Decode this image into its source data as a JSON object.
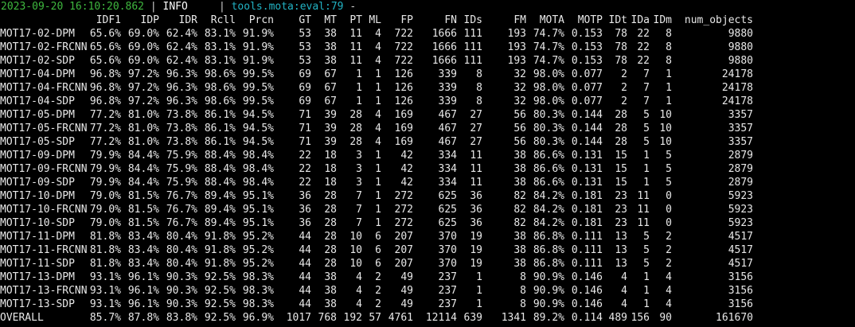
{
  "log": {
    "timestamp": "2023-09-20 16:10:20.862",
    "separator1": " | ",
    "level": "INFO    ",
    "separator2": " | ",
    "location": "tools.mota:eval:79",
    "suffix": " - "
  },
  "table": {
    "columns": [
      "",
      "IDF1",
      "IDP",
      "IDR",
      "Rcll",
      "Prcn",
      "GT",
      "MT",
      "PT",
      "ML",
      "FP",
      "FN",
      "IDs",
      "FM",
      "MOTA",
      "MOTP",
      "IDt",
      "IDa",
      "IDm",
      "num_objects"
    ],
    "rows": [
      [
        "MOT17-02-DPM",
        "65.6%",
        "69.0%",
        "62.4%",
        "83.1%",
        "91.9%",
        "53",
        "38",
        "11",
        "4",
        "722",
        "1666",
        "111",
        "193",
        "74.7%",
        "0.153",
        "78",
        "22",
        "8",
        "9880"
      ],
      [
        "MOT17-02-FRCNN",
        "65.6%",
        "69.0%",
        "62.4%",
        "83.1%",
        "91.9%",
        "53",
        "38",
        "11",
        "4",
        "722",
        "1666",
        "111",
        "193",
        "74.7%",
        "0.153",
        "78",
        "22",
        "8",
        "9880"
      ],
      [
        "MOT17-02-SDP",
        "65.6%",
        "69.0%",
        "62.4%",
        "83.1%",
        "91.9%",
        "53",
        "38",
        "11",
        "4",
        "722",
        "1666",
        "111",
        "193",
        "74.7%",
        "0.153",
        "78",
        "22",
        "8",
        "9880"
      ],
      [
        "MOT17-04-DPM",
        "96.8%",
        "97.2%",
        "96.3%",
        "98.6%",
        "99.5%",
        "69",
        "67",
        "1",
        "1",
        "126",
        "339",
        "8",
        "32",
        "98.0%",
        "0.077",
        "2",
        "7",
        "1",
        "24178"
      ],
      [
        "MOT17-04-FRCNN",
        "96.8%",
        "97.2%",
        "96.3%",
        "98.6%",
        "99.5%",
        "69",
        "67",
        "1",
        "1",
        "126",
        "339",
        "8",
        "32",
        "98.0%",
        "0.077",
        "2",
        "7",
        "1",
        "24178"
      ],
      [
        "MOT17-04-SDP",
        "96.8%",
        "97.2%",
        "96.3%",
        "98.6%",
        "99.5%",
        "69",
        "67",
        "1",
        "1",
        "126",
        "339",
        "8",
        "32",
        "98.0%",
        "0.077",
        "2",
        "7",
        "1",
        "24178"
      ],
      [
        "MOT17-05-DPM",
        "77.2%",
        "81.0%",
        "73.8%",
        "86.1%",
        "94.5%",
        "71",
        "39",
        "28",
        "4",
        "169",
        "467",
        "27",
        "56",
        "80.3%",
        "0.144",
        "28",
        "5",
        "10",
        "3357"
      ],
      [
        "MOT17-05-FRCNN",
        "77.2%",
        "81.0%",
        "73.8%",
        "86.1%",
        "94.5%",
        "71",
        "39",
        "28",
        "4",
        "169",
        "467",
        "27",
        "56",
        "80.3%",
        "0.144",
        "28",
        "5",
        "10",
        "3357"
      ],
      [
        "MOT17-05-SDP",
        "77.2%",
        "81.0%",
        "73.8%",
        "86.1%",
        "94.5%",
        "71",
        "39",
        "28",
        "4",
        "169",
        "467",
        "27",
        "56",
        "80.3%",
        "0.144",
        "28",
        "5",
        "10",
        "3357"
      ],
      [
        "MOT17-09-DPM",
        "79.9%",
        "84.4%",
        "75.9%",
        "88.4%",
        "98.4%",
        "22",
        "18",
        "3",
        "1",
        "42",
        "334",
        "11",
        "38",
        "86.6%",
        "0.131",
        "15",
        "1",
        "5",
        "2879"
      ],
      [
        "MOT17-09-FRCNN",
        "79.9%",
        "84.4%",
        "75.9%",
        "88.4%",
        "98.4%",
        "22",
        "18",
        "3",
        "1",
        "42",
        "334",
        "11",
        "38",
        "86.6%",
        "0.131",
        "15",
        "1",
        "5",
        "2879"
      ],
      [
        "MOT17-09-SDP",
        "79.9%",
        "84.4%",
        "75.9%",
        "88.4%",
        "98.4%",
        "22",
        "18",
        "3",
        "1",
        "42",
        "334",
        "11",
        "38",
        "86.6%",
        "0.131",
        "15",
        "1",
        "5",
        "2879"
      ],
      [
        "MOT17-10-DPM",
        "79.0%",
        "81.5%",
        "76.7%",
        "89.4%",
        "95.1%",
        "36",
        "28",
        "7",
        "1",
        "272",
        "625",
        "36",
        "82",
        "84.2%",
        "0.181",
        "23",
        "11",
        "0",
        "5923"
      ],
      [
        "MOT17-10-FRCNN",
        "79.0%",
        "81.5%",
        "76.7%",
        "89.4%",
        "95.1%",
        "36",
        "28",
        "7",
        "1",
        "272",
        "625",
        "36",
        "82",
        "84.2%",
        "0.181",
        "23",
        "11",
        "0",
        "5923"
      ],
      [
        "MOT17-10-SDP",
        "79.0%",
        "81.5%",
        "76.7%",
        "89.4%",
        "95.1%",
        "36",
        "28",
        "7",
        "1",
        "272",
        "625",
        "36",
        "82",
        "84.2%",
        "0.181",
        "23",
        "11",
        "0",
        "5923"
      ],
      [
        "MOT17-11-DPM",
        "81.8%",
        "83.4%",
        "80.4%",
        "91.8%",
        "95.2%",
        "44",
        "28",
        "10",
        "6",
        "207",
        "370",
        "19",
        "38",
        "86.8%",
        "0.111",
        "13",
        "5",
        "2",
        "4517"
      ],
      [
        "MOT17-11-FRCNN",
        "81.8%",
        "83.4%",
        "80.4%",
        "91.8%",
        "95.2%",
        "44",
        "28",
        "10",
        "6",
        "207",
        "370",
        "19",
        "38",
        "86.8%",
        "0.111",
        "13",
        "5",
        "2",
        "4517"
      ],
      [
        "MOT17-11-SDP",
        "81.8%",
        "83.4%",
        "80.4%",
        "91.8%",
        "95.2%",
        "44",
        "28",
        "10",
        "6",
        "207",
        "370",
        "19",
        "38",
        "86.8%",
        "0.111",
        "13",
        "5",
        "2",
        "4517"
      ],
      [
        "MOT17-13-DPM",
        "93.1%",
        "96.1%",
        "90.3%",
        "92.5%",
        "98.3%",
        "44",
        "38",
        "4",
        "2",
        "49",
        "237",
        "1",
        "8",
        "90.9%",
        "0.146",
        "4",
        "1",
        "4",
        "3156"
      ],
      [
        "MOT17-13-FRCNN",
        "93.1%",
        "96.1%",
        "90.3%",
        "92.5%",
        "98.3%",
        "44",
        "38",
        "4",
        "2",
        "49",
        "237",
        "1",
        "8",
        "90.9%",
        "0.146",
        "4",
        "1",
        "4",
        "3156"
      ],
      [
        "MOT17-13-SDP",
        "93.1%",
        "96.1%",
        "90.3%",
        "92.5%",
        "98.3%",
        "44",
        "38",
        "4",
        "2",
        "49",
        "237",
        "1",
        "8",
        "90.9%",
        "0.146",
        "4",
        "1",
        "4",
        "3156"
      ],
      [
        "OVERALL",
        "85.7%",
        "87.8%",
        "83.8%",
        "92.5%",
        "96.9%",
        "1017",
        "768",
        "192",
        "57",
        "4761",
        "12114",
        "639",
        "1341",
        "89.2%",
        "0.114",
        "489",
        "156",
        "90",
        "161670"
      ]
    ]
  },
  "colors": {
    "background": "#000000",
    "text": "#e8e8e8",
    "timestamp": "#3fb83f",
    "location": "#22b3c4"
  }
}
